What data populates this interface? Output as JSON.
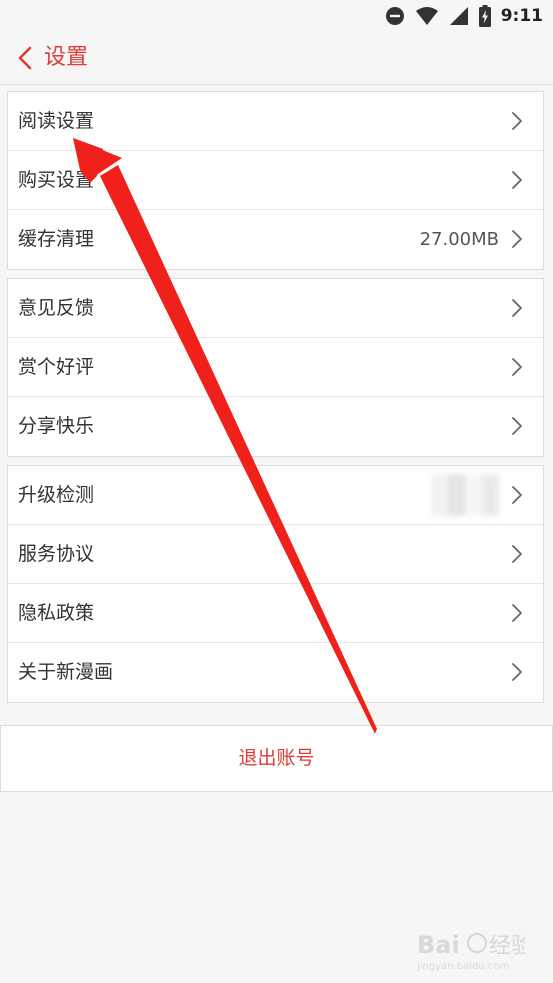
{
  "status_bar": {
    "time": "9:11",
    "icons": [
      "do-not-disturb-icon",
      "wifi-icon",
      "signal-icon",
      "battery-charging-icon"
    ]
  },
  "header": {
    "title": "设置",
    "back_icon": "chevron-left-icon"
  },
  "groups": [
    {
      "items": [
        {
          "label": "阅读设置",
          "value": ""
        },
        {
          "label": "购买设置",
          "value": ""
        },
        {
          "label": "缓存清理",
          "value": "27.00MB"
        }
      ]
    },
    {
      "items": [
        {
          "label": "意见反馈",
          "value": ""
        },
        {
          "label": "赏个好评",
          "value": ""
        },
        {
          "label": "分享快乐",
          "value": ""
        }
      ]
    },
    {
      "items": [
        {
          "label": "升级检测",
          "value": ""
        },
        {
          "label": "服务协议",
          "value": ""
        },
        {
          "label": "隐私政策",
          "value": ""
        },
        {
          "label": "关于新漫画",
          "value": ""
        }
      ]
    }
  ],
  "logout_label": "退出账号",
  "colors": {
    "accent": "#e13a37",
    "background": "#f6f6f6",
    "row_background": "#ffffff",
    "annotation_arrow": "#f0201a"
  }
}
